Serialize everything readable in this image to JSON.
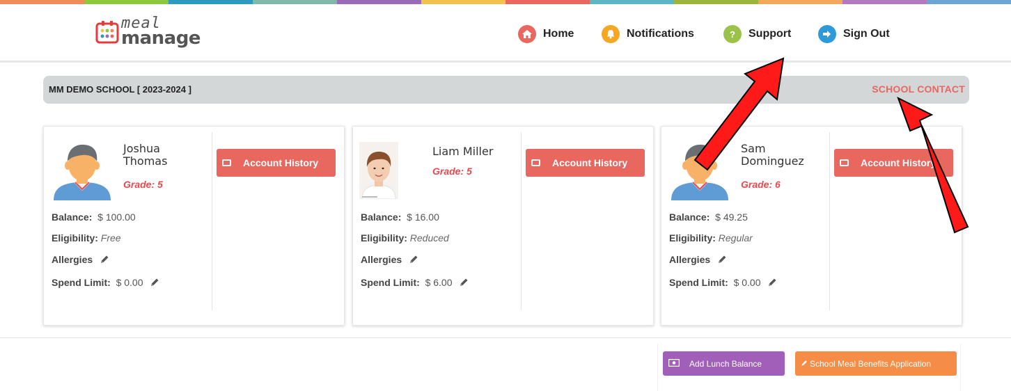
{
  "brand": {
    "line1": "meal",
    "line2": "manage",
    "stripe_colors": [
      "#f18a5b",
      "#8dc63f",
      "#2f9ac1",
      "#7db9a6",
      "#9a6bb8",
      "#f2c14e",
      "#e8675f",
      "#5bb7c5",
      "#9bb53c",
      "#f3a75a",
      "#b37ac2",
      "#6ca5d4"
    ]
  },
  "nav": {
    "home": "Home",
    "notifications": "Notifications",
    "support": "Support",
    "signout": "Sign Out"
  },
  "school": {
    "name": "MM DEMO SCHOOL [ 2023-2024 ]",
    "contact": "SCHOOL CONTACT"
  },
  "labels": {
    "account_history": "Account History",
    "balance": "Balance:",
    "eligibility": "Eligibility:",
    "allergies": "Allergies",
    "spend_limit": "Spend Limit:",
    "grade": "Grade:"
  },
  "students": [
    {
      "first": "Joshua",
      "last": "Thomas",
      "grade": "5",
      "balance": "$ 100.00",
      "eligibility": "Free",
      "spend_limit": "$ 0.00"
    },
    {
      "full": "Liam Miller",
      "grade": "5",
      "balance": "$ 16.00",
      "eligibility": "Reduced",
      "spend_limit": "$ 6.00"
    },
    {
      "first": "Sam",
      "last": "Dominguez",
      "grade": "6",
      "balance": "$ 49.25",
      "eligibility": "Regular",
      "spend_limit": "$ 0.00"
    }
  ],
  "actions": {
    "add_lunch": "Add Lunch Balance",
    "meal_benefits": "School Meal Benefits Application"
  },
  "colors": {
    "accent_red": "#e8675f",
    "grade_red": "#e8484e",
    "purple": "#a15fb9",
    "orange": "#f58d47",
    "annotation_arrow": "#ff0000"
  }
}
